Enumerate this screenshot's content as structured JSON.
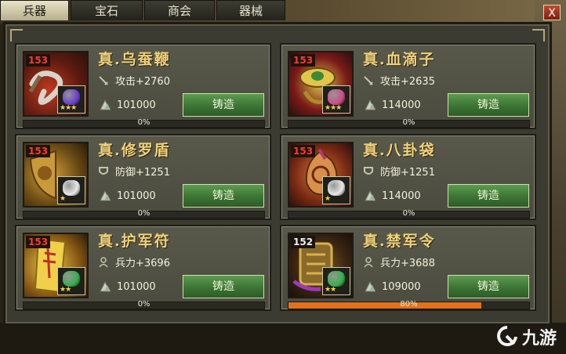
{
  "tabs": [
    {
      "label": "兵器",
      "active": true
    },
    {
      "label": "宝石",
      "active": false
    },
    {
      "label": "商会",
      "active": false
    },
    {
      "label": "器械",
      "active": false
    }
  ],
  "close_label": "X",
  "cards": [
    {
      "level": "153",
      "name": "真.乌蚕鞭",
      "stat": "攻击+2760",
      "stat_icon": "sword-icon",
      "cost": "101000",
      "button": "铸造",
      "progress_text": "0%",
      "progress": 0,
      "gem_color": "#6b3fd0",
      "stars": "★★★"
    },
    {
      "level": "153",
      "name": "真.血滴子",
      "stat": "攻击+2635",
      "stat_icon": "sword-icon",
      "cost": "114000",
      "button": "铸造",
      "progress_text": "0%",
      "progress": 0,
      "gem_color": "#d04a8a",
      "stars": "★★★"
    },
    {
      "level": "153",
      "name": "真.修罗盾",
      "stat": "防御+1251",
      "stat_icon": "shield-icon",
      "cost": "101000",
      "button": "铸造",
      "progress_text": "0%",
      "progress": 0,
      "gem_color": "#e8e8e8",
      "stars": "★"
    },
    {
      "level": "153",
      "name": "真.八卦袋",
      "stat": "防御+1251",
      "stat_icon": "shield-icon",
      "cost": "114000",
      "button": "铸造",
      "progress_text": "0%",
      "progress": 0,
      "gem_color": "#e8e8e8",
      "stars": "★"
    },
    {
      "level": "153",
      "name": "真.护军符",
      "stat": "兵力+3696",
      "stat_icon": "soldier-icon",
      "cost": "101000",
      "button": "铸造",
      "progress_text": "0%",
      "progress": 0,
      "gem_color": "#35b14a",
      "stars": "★★"
    },
    {
      "level": "152",
      "name": "真.禁军令",
      "stat": "兵力+3688",
      "stat_icon": "soldier-icon",
      "cost": "109000",
      "button": "铸造",
      "progress_text": "80%",
      "progress": 0.8,
      "gem_color": "#35b14a",
      "stars": "★★"
    }
  ],
  "watermark": {
    "text": "九游"
  }
}
